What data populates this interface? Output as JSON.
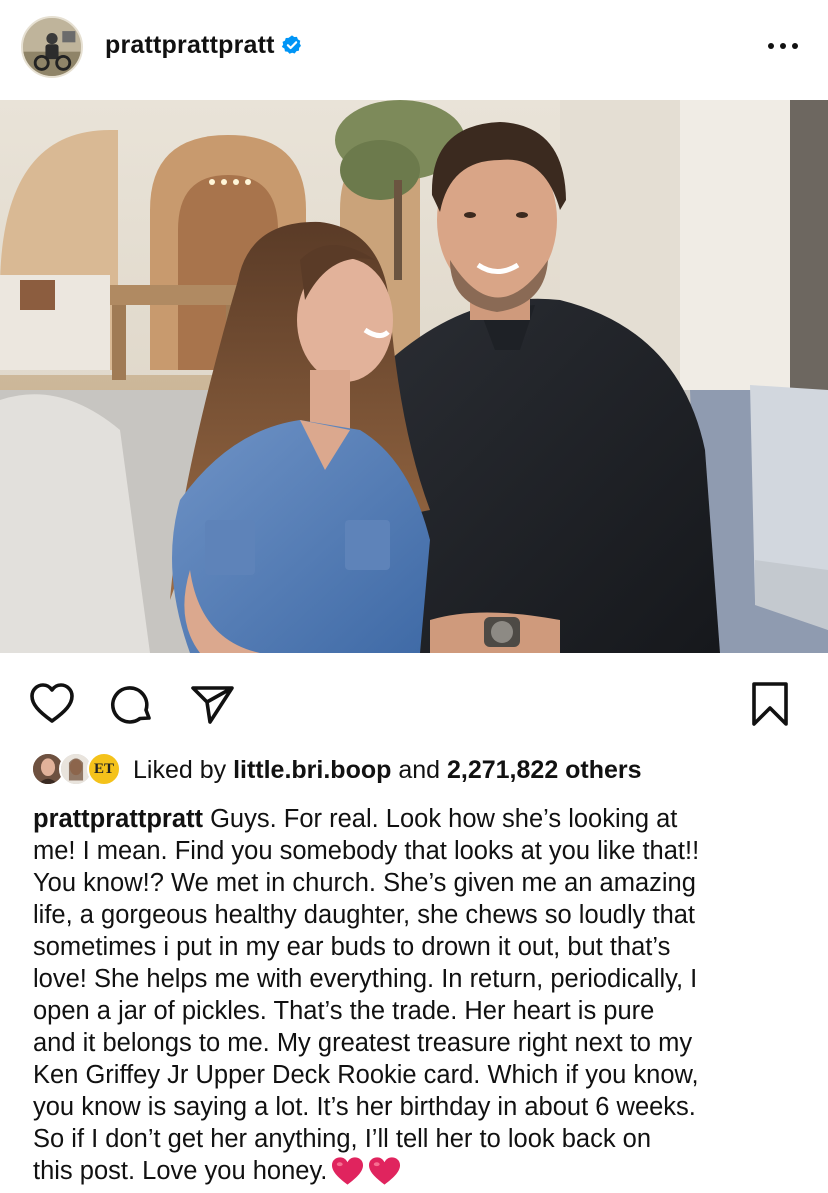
{
  "post": {
    "username": "prattprattpratt",
    "verified_icon": "verified-badge-icon",
    "more_icon": "more-options-icon"
  },
  "actions": {
    "like_icon": "heart-outline-icon",
    "comment_icon": "comment-bubble-icon",
    "share_icon": "paper-plane-icon",
    "save_icon": "bookmark-icon"
  },
  "likes": {
    "prefix": "Liked by ",
    "user": "little.bri.boop",
    "middle": " and ",
    "count": "2,271,822 others",
    "avatar_badge": "ET"
  },
  "caption": {
    "author": "prattprattpratt",
    "lines": [
      " Guys. For real. Look how she’s looking at",
      "me! I mean. Find you somebody that looks at you like that!!",
      "You know!? We met in church. She’s given me an amazing",
      "life, a gorgeous healthy daughter, she chews so loudly that",
      "sometimes i put in my ear buds to drown it out, but that’s",
      "love! She helps me with everything. In return, periodically, I",
      "open a jar of pickles. That’s the trade. Her heart is pure",
      "and it belongs to me. My greatest treasure right next to my",
      "Ken Griffey Jr Upper Deck Rookie card. Which if you know,",
      "you know is saying a lot. It’s her birthday in about 6 weeks.",
      "So if I don’t get her anything, I’ll tell her to look back on",
      "this post. Love you honey."
    ],
    "emoji": [
      "red-heart",
      "red-heart"
    ]
  },
  "colors": {
    "verified_blue": "#0095f6",
    "heart_red": "#e0245e",
    "text": "#111111"
  }
}
